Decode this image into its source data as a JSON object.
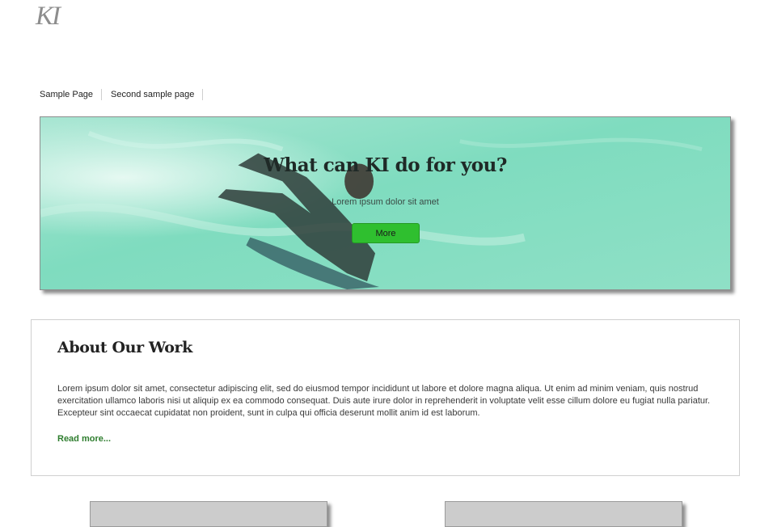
{
  "site": {
    "logo_text": "KI"
  },
  "nav": {
    "items": [
      {
        "label": "Sample Page"
      },
      {
        "label": "Second sample page"
      }
    ]
  },
  "hero": {
    "title": "What can KI do for you?",
    "subtitle": "Lorem ipsum dolor sit amet",
    "button_label": "More",
    "accent_color": "#2fbf2f",
    "image": "surfer-on-green-wave"
  },
  "about": {
    "heading": "About Our Work",
    "body": "Lorem ipsum dolor sit amet, consectetur adipiscing elit, sed do eiusmod tempor incididunt ut labore et dolore magna aliqua. Ut enim ad minim veniam, quis nostrud exercitation ullamco laboris nisi ut aliquip ex ea commodo consequat. Duis aute irure dolor in reprehenderit in voluptate velit esse cillum dolore eu fugiat nulla pariatur. Excepteur sint occaecat cupidatat non proident, sunt in culpa qui officia deserunt mollit anim id est laborum.",
    "read_more": "Read more...",
    "link_color": "#2e7d2e"
  }
}
